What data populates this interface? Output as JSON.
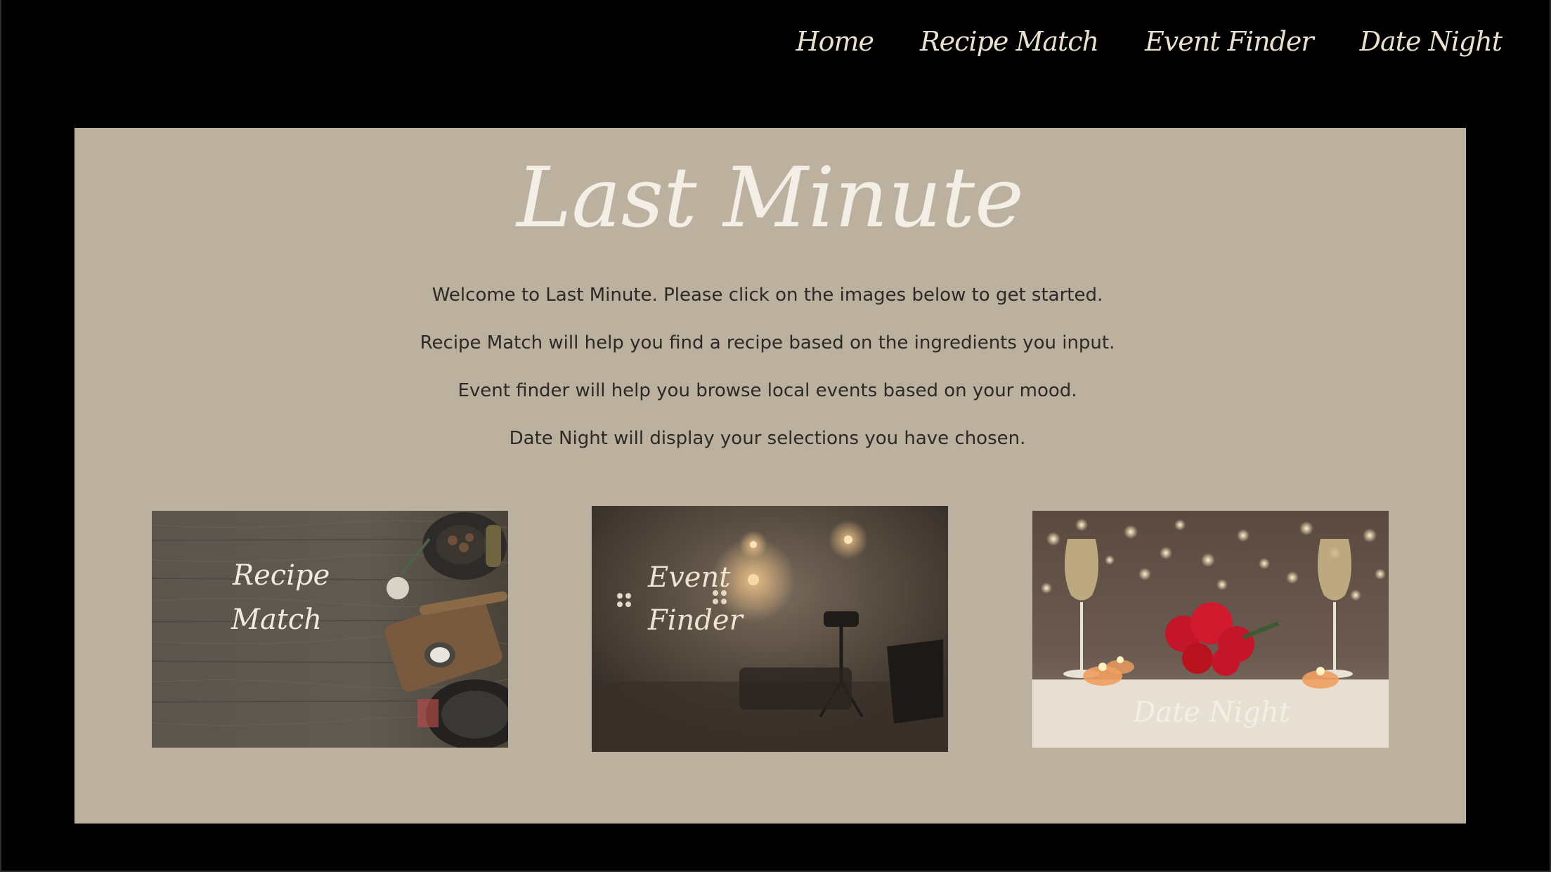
{
  "nav": {
    "items": [
      {
        "label": "Home"
      },
      {
        "label": "Recipe Match"
      },
      {
        "label": "Event Finder"
      },
      {
        "label": "Date Night"
      }
    ]
  },
  "logo": {
    "text": "Last Minute"
  },
  "intro": {
    "lines": [
      "Welcome to Last Minute. Please click on the images below to get started.",
      "Recipe Match will help you find a recipe based on the ingredients you input.",
      "Event finder will help you browse local events based on your mood.",
      "Date Night will display your selections you have chosen."
    ]
  },
  "cards": [
    {
      "label_line1": "Recipe",
      "label_line2": "Match"
    },
    {
      "label_line1": "Event",
      "label_line2": "Finder"
    },
    {
      "label": "Date Night"
    }
  ],
  "colors": {
    "page_background": "#000000",
    "panel_background": "#bcb09f",
    "nav_text": "#e9e0cf",
    "body_text": "#2c2a27",
    "logo_text": "#f4efe6"
  }
}
